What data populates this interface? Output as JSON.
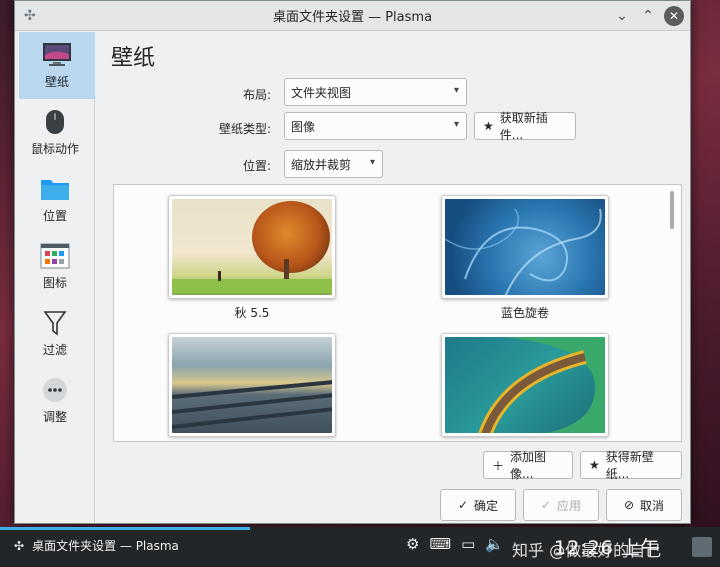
{
  "window": {
    "title": "桌面文件夹设置 — Plasma"
  },
  "sidebar": {
    "items": [
      {
        "label": "壁纸",
        "icon": "monitor-icon"
      },
      {
        "label": "鼠标动作",
        "icon": "mouse-icon"
      },
      {
        "label": "位置",
        "icon": "folder-icon"
      },
      {
        "label": "图标",
        "icon": "icons-icon"
      },
      {
        "label": "过滤",
        "icon": "filter-icon"
      },
      {
        "label": "调整",
        "icon": "more-icon"
      }
    ]
  },
  "main": {
    "title": "壁纸",
    "layout_label": "布局:",
    "layout_value": "文件夹视图",
    "type_label": "壁纸类型:",
    "type_value": "图像",
    "get_plugins_label": "获取新插件...",
    "position_label": "位置:",
    "position_value": "缩放并裁剪",
    "wallpapers": [
      {
        "label": "秋 5.5"
      },
      {
        "label": "蓝色旋卷"
      },
      {
        "label": ""
      },
      {
        "label": ""
      }
    ],
    "add_image_label": "添加图像...",
    "get_wallpapers_label": "获得新壁纸...",
    "ok_label": "确定",
    "apply_label": "应用",
    "cancel_label": "取消"
  },
  "taskbar": {
    "task_label": "桌面文件夹设置 — Plasma",
    "clock": "12:26 上午",
    "watermark": "知乎 @做最好的自己"
  },
  "colors": {
    "accent": "#3daee9",
    "selection": "#b9d7ef",
    "window_bg": "#eff0f1",
    "taskbar_bg": "#232629"
  }
}
